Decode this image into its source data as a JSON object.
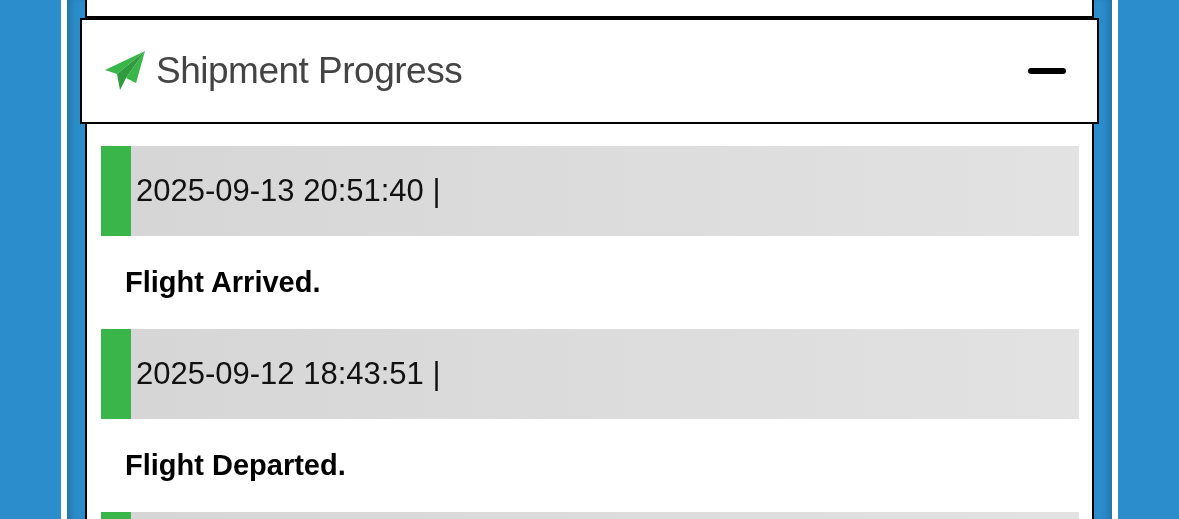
{
  "card": {
    "title": "Shipment Progress",
    "expanded": true
  },
  "events": [
    {
      "time": "2025-09-13 20:51:40 |",
      "status": "Flight Arrived."
    },
    {
      "time": "2025-09-12 18:43:51 |",
      "status": "Flight Departed."
    }
  ]
}
